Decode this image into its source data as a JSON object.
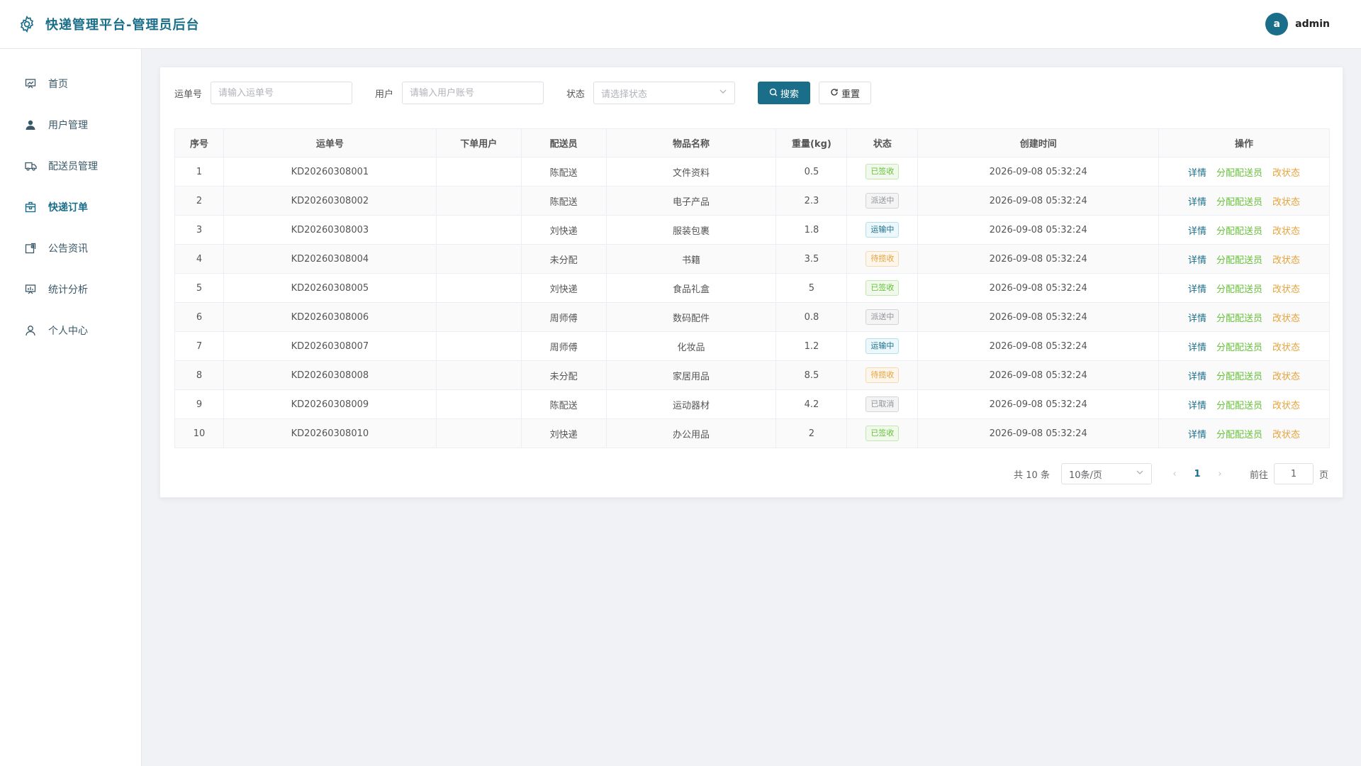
{
  "header": {
    "title": "快递管理平台-管理员后台",
    "icon": "gear-icon",
    "avatar_letter": "a",
    "username": "admin"
  },
  "sidebar": {
    "items": [
      {
        "label": "首页",
        "icon": "dashboard-icon"
      },
      {
        "label": "用户管理",
        "icon": "user-icon"
      },
      {
        "label": "配送员管理",
        "icon": "truck-icon"
      },
      {
        "label": "快递订单",
        "icon": "package-icon",
        "active": true
      },
      {
        "label": "公告资讯",
        "icon": "notice-icon"
      },
      {
        "label": "统计分析",
        "icon": "chart-icon"
      },
      {
        "label": "个人中心",
        "icon": "person-icon"
      }
    ]
  },
  "filters": {
    "waybill_label": "运单号",
    "waybill_placeholder": "请输入运单号",
    "user_label": "用户",
    "user_placeholder": "请输入用户账号",
    "status_label": "状态",
    "status_placeholder": "请选择状态",
    "search_label": "搜索",
    "reset_label": "重置"
  },
  "table": {
    "headers": [
      "序号",
      "运单号",
      "下单用户",
      "配送员",
      "物品名称",
      "重量(kg)",
      "状态",
      "创建时间",
      "操作"
    ],
    "actions": {
      "detail": "详情",
      "assign": "分配配送员",
      "change": "改状态"
    },
    "rows": [
      {
        "idx": "1",
        "no": "KD20260308001",
        "user": "",
        "courier": "陈配送",
        "item": "文件资料",
        "weight": "0.5",
        "status": "已签收",
        "time": "2026-09-08 05:32:24"
      },
      {
        "idx": "2",
        "no": "KD20260308002",
        "user": "",
        "courier": "陈配送",
        "item": "电子产品",
        "weight": "2.3",
        "status": "派送中",
        "time": "2026-09-08 05:32:24"
      },
      {
        "idx": "3",
        "no": "KD20260308003",
        "user": "",
        "courier": "刘快递",
        "item": "服装包裹",
        "weight": "1.8",
        "status": "运输中",
        "time": "2026-09-08 05:32:24"
      },
      {
        "idx": "4",
        "no": "KD20260308004",
        "user": "",
        "courier": "未分配",
        "item": "书籍",
        "weight": "3.5",
        "status": "待揽收",
        "time": "2026-09-08 05:32:24"
      },
      {
        "idx": "5",
        "no": "KD20260308005",
        "user": "",
        "courier": "刘快递",
        "item": "食品礼盒",
        "weight": "5",
        "status": "已签收",
        "time": "2026-09-08 05:32:24"
      },
      {
        "idx": "6",
        "no": "KD20260308006",
        "user": "",
        "courier": "周师傅",
        "item": "数码配件",
        "weight": "0.8",
        "status": "派送中",
        "time": "2026-09-08 05:32:24"
      },
      {
        "idx": "7",
        "no": "KD20260308007",
        "user": "",
        "courier": "周师傅",
        "item": "化妆品",
        "weight": "1.2",
        "status": "运输中",
        "time": "2026-09-08 05:32:24"
      },
      {
        "idx": "8",
        "no": "KD20260308008",
        "user": "",
        "courier": "未分配",
        "item": "家居用品",
        "weight": "8.5",
        "status": "待揽收",
        "time": "2026-09-08 05:32:24"
      },
      {
        "idx": "9",
        "no": "KD20260308009",
        "user": "",
        "courier": "陈配送",
        "item": "运动器材",
        "weight": "4.2",
        "status": "已取消",
        "time": "2026-09-08 05:32:24"
      },
      {
        "idx": "10",
        "no": "KD20260308010",
        "user": "",
        "courier": "刘快递",
        "item": "办公用品",
        "weight": "2",
        "status": "已签收",
        "time": "2026-09-08 05:32:24"
      }
    ]
  },
  "status_colors": {
    "已签收": {
      "text": "#67c23a",
      "bg": "#f0f9eb",
      "border": "#c2e7b0"
    },
    "派送中": {
      "text": "#909399",
      "bg": "#f4f4f5",
      "border": "#d3d4d6"
    },
    "运输中": {
      "text": "#1b6e8a",
      "bg": "#ecf8fb",
      "border": "#b3e0ea"
    },
    "待揽收": {
      "text": "#e6a23c",
      "bg": "#fdf6ec",
      "border": "#f5dab1"
    },
    "已取消": {
      "text": "#909399",
      "bg": "#f4f4f5",
      "border": "#d3d4d6"
    }
  },
  "action_colors": {
    "detail": "#1b6e8a",
    "assign": "#67c23a",
    "change": "#e6a23c"
  },
  "pagination": {
    "total": "共 10 条",
    "page_size": "10条/页",
    "current": "1",
    "goto_label": "前往",
    "goto_value": "1",
    "page_suffix": "页"
  },
  "colors": {
    "accent": "#1b6e8a"
  }
}
